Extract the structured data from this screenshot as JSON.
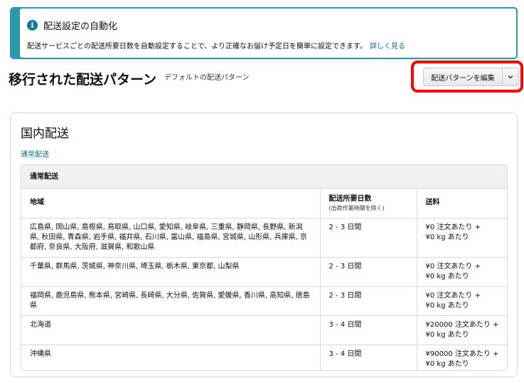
{
  "info": {
    "title": "配送設定の自動化",
    "text": "配送サービスごとの配送所要日数を自動設定することで、より正確なお届け予定日を簡単に設定できます。",
    "link": "詳しく見る"
  },
  "header": {
    "title": "移行された配送パターン",
    "subtitle": "デフォルトの配送パターン",
    "edit_button": "配送パターンを編集"
  },
  "domestic": {
    "title": "国内配送",
    "link": "通常配送",
    "table": {
      "caption": "通常配送",
      "columns": {
        "region": "地域",
        "days": "配送所要日数",
        "days_note": "(出荷作業時間を除く)",
        "fee": "送料"
      },
      "rows": [
        {
          "region": "広島県, 岡山県, 島根県, 鳥取県, 山口県, 愛知県, 岐阜県, 三重県, 静岡県, 長野県, 新潟県, 秋田県, 青森県, 岩手県, 福井県, 石川県, 富山県, 福島県, 宮城県, 山形県, 兵庫県, 京都府, 奈良県, 大阪府, 滋賀県, 和歌山県",
          "days": "2 - 3 日間",
          "fee_order": "¥0 注文あたり +",
          "fee_kg": "¥0 kg あたり"
        },
        {
          "region": "千葉県, 群馬県, 茨城県, 神奈川県, 埼玉県, 栃木県, 東京都, 山梨県",
          "days": "2 - 3 日間",
          "fee_order": "¥0 注文あたり +",
          "fee_kg": "¥0 kg あたり"
        },
        {
          "region": "福岡県, 鹿児島県, 熊本県, 宮崎県, 長崎県, 大分県, 佐賀県, 愛媛県, 香川県, 高知県, 徳島県",
          "days": "2 - 3 日間",
          "fee_order": "¥0 注文あたり +",
          "fee_kg": "¥0 kg あたり"
        },
        {
          "region": "北海道",
          "days": "3 - 4 日間",
          "fee_order": "¥20000 注文あたり +",
          "fee_kg": "¥0 kg あたり"
        },
        {
          "region": "沖縄県",
          "days": "3 - 4 日間",
          "fee_order": "¥90000 注文あたり +",
          "fee_kg": "¥0 kg あたり"
        }
      ]
    }
  },
  "icons": {
    "info": "info-icon",
    "caret": "chevron-down-icon"
  },
  "colors": {
    "accent": "#2a9aab",
    "link": "#007185",
    "highlight": "#ff0000"
  }
}
